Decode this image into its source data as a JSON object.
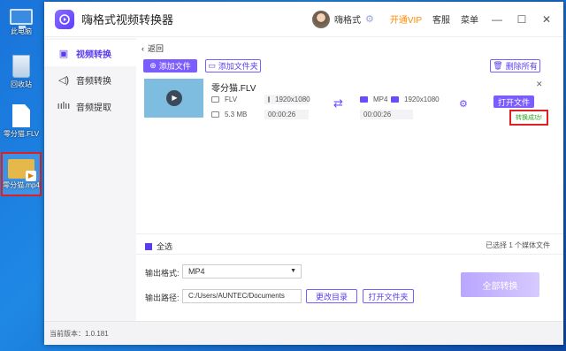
{
  "desktop": {
    "icons": [
      {
        "label": "此电脑"
      },
      {
        "label": "回收站"
      },
      {
        "label": "零分猫.FLV"
      },
      {
        "label": "零分猫.mp4"
      }
    ]
  },
  "window": {
    "title": "嗨格式视频转换器",
    "user_name": "嗨格式",
    "vip_label": "开通VIP",
    "service_label": "客服",
    "menu_label": "菜单",
    "min_glyph": "—",
    "max_glyph": "☐",
    "close_glyph": "✕"
  },
  "sidebar": {
    "items": [
      {
        "label": "视频转换",
        "icon": "video-convert-icon",
        "active": true
      },
      {
        "label": "音频转换",
        "icon": "speaker-icon",
        "active": false
      },
      {
        "label": "音频提取",
        "icon": "waveform-icon",
        "active": false
      }
    ]
  },
  "toolbar": {
    "back_label": "返回",
    "add_file_label": "添加文件",
    "add_folder_label": "添加文件夹",
    "delete_all_label": "删除所有"
  },
  "file": {
    "name": "零分猫.FLV",
    "src_format": "FLV",
    "src_resolution": "1920x1080",
    "src_size": "5.3 MB",
    "src_duration": "00:00:26",
    "out_format": "MP4",
    "out_resolution": "1920x1080",
    "out_duration": "00:00:26",
    "open_file_label": "打开文件",
    "status": "转换成功!"
  },
  "bottom": {
    "select_all_label": "全选",
    "selected_count": "已选择 1 个媒体文件",
    "output_format_label": "输出格式:",
    "output_format_value": "MP4",
    "output_path_label": "输出路径:",
    "output_path_value": "C:/Users/AUNTEC/Documents",
    "change_dir_label": "更改目录",
    "open_folder_label": "打开文件夹",
    "convert_all_label": "全部转换"
  },
  "statusbar": {
    "version": "当前版本：1.0.181"
  },
  "colors": {
    "accent": "#7b5cff",
    "vip": "#ff8a00",
    "success": "#2aa520",
    "highlight": "#e02020"
  }
}
